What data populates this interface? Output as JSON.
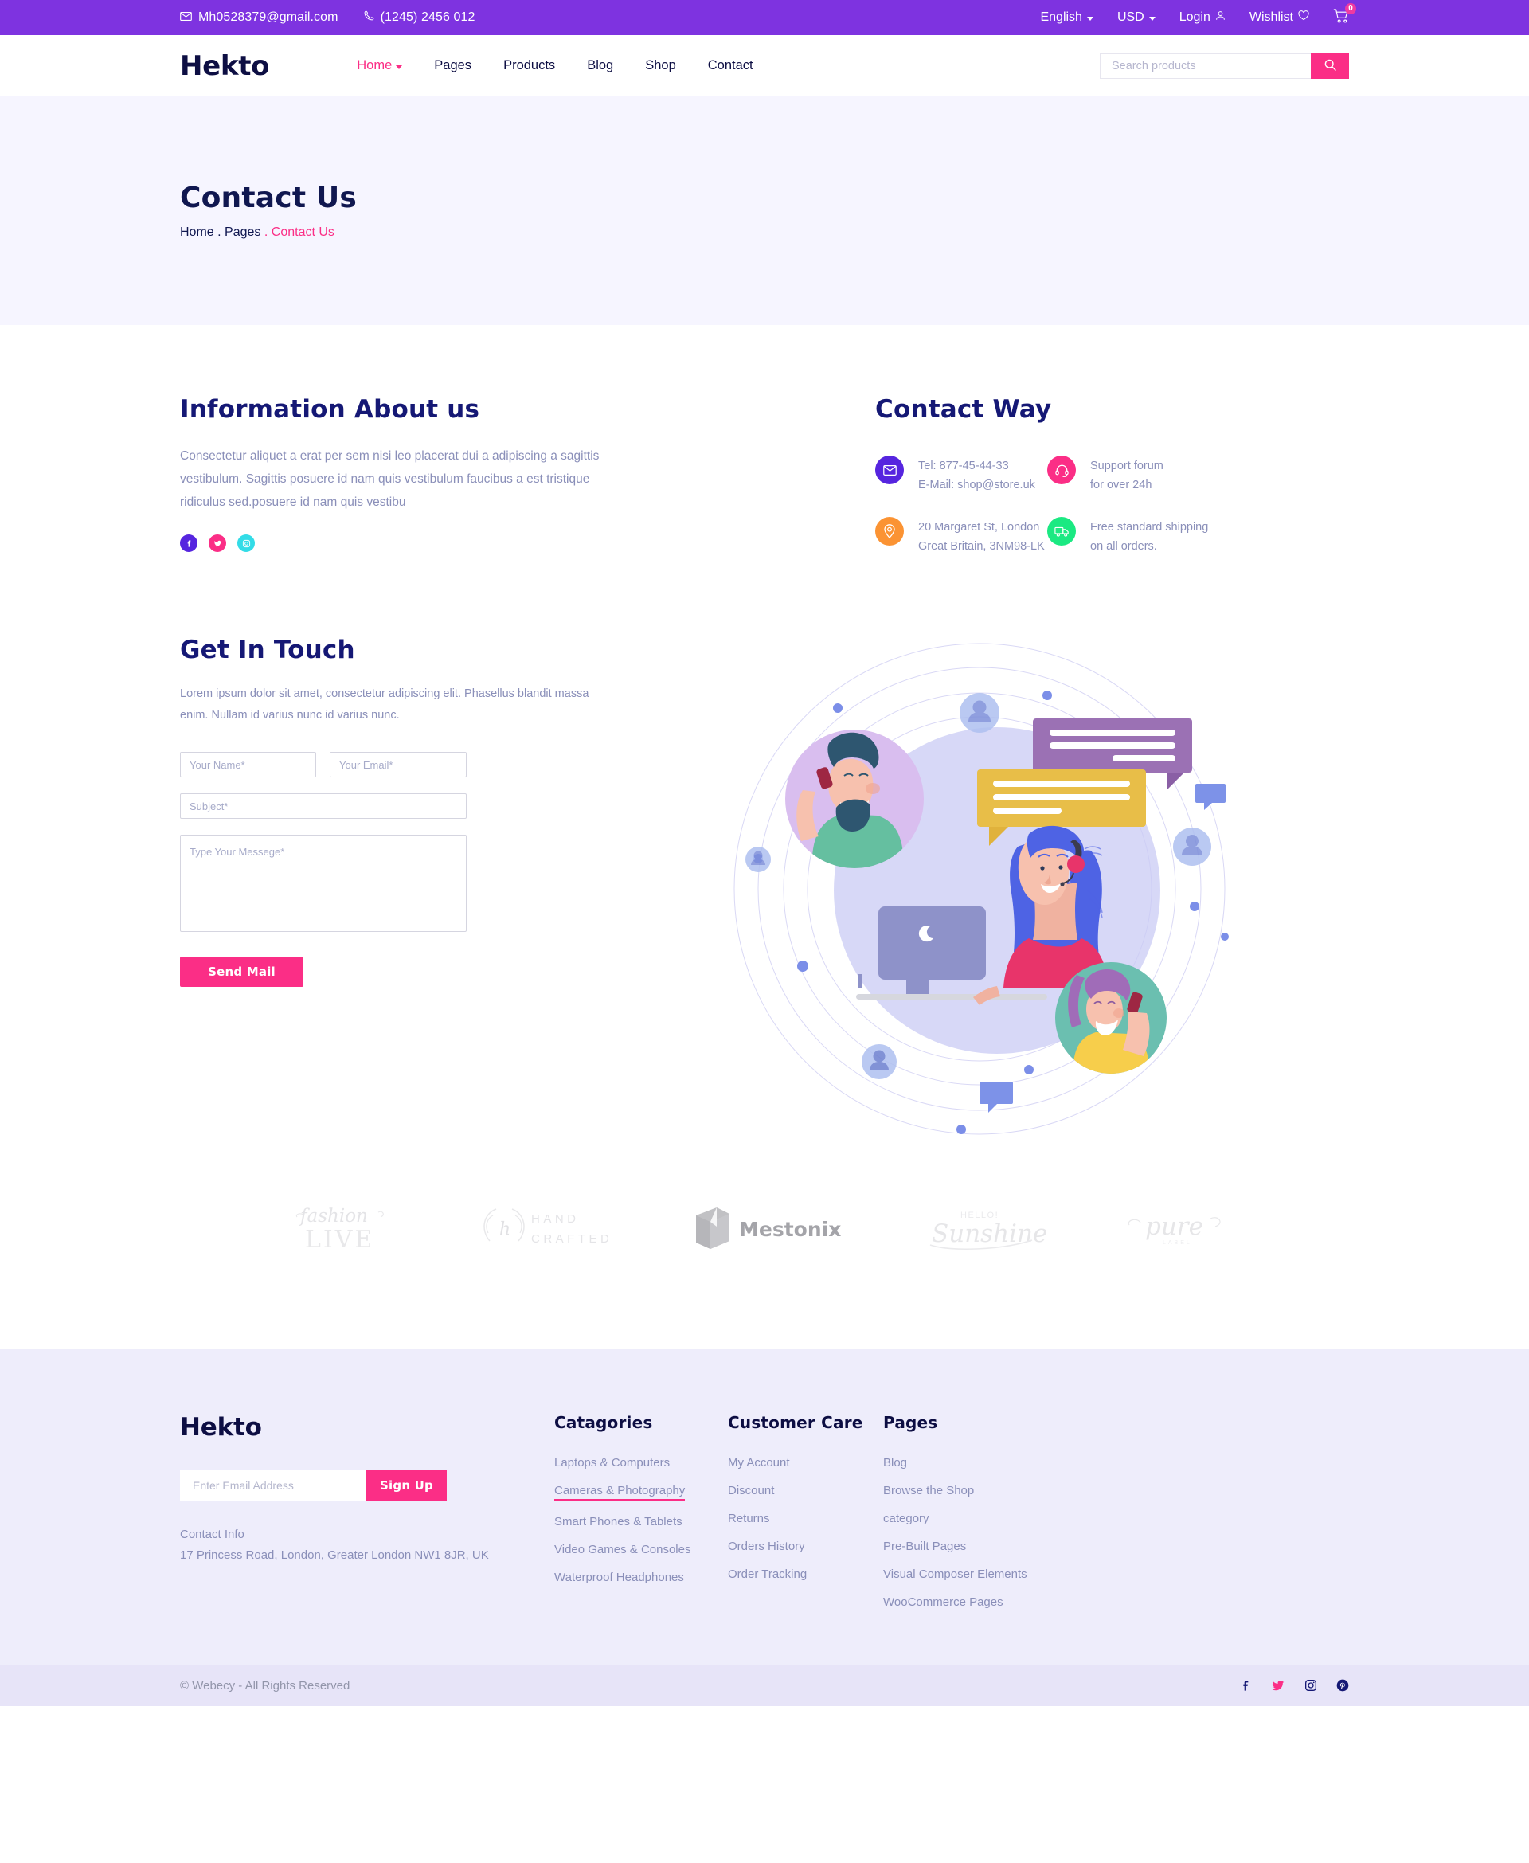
{
  "topbar": {
    "email": "Mh0528379@gmail.com",
    "phone": "(1245) 2456 012",
    "language": "English",
    "currency": "USD",
    "login": "Login",
    "wishlist": "Wishlist",
    "cart_count": "0"
  },
  "header": {
    "logo": "Hekto",
    "nav": [
      {
        "label": "Home",
        "active": true,
        "caret": true
      },
      {
        "label": "Pages",
        "active": false,
        "caret": false
      },
      {
        "label": "Products",
        "active": false,
        "caret": false
      },
      {
        "label": "Blog",
        "active": false,
        "caret": false
      },
      {
        "label": "Shop",
        "active": false,
        "caret": false
      },
      {
        "label": "Contact",
        "active": false,
        "caret": false
      }
    ],
    "search_placeholder": "Search products"
  },
  "hero": {
    "title": "Contact Us",
    "crumb_home": "Home",
    "crumb_sep1": ".",
    "crumb_pages": "Pages",
    "crumb_sep2": ".",
    "crumb_current": "Contact Us"
  },
  "info": {
    "title": "Information About us",
    "paragraph": "Consectetur aliquet a erat per sem nisi leo placerat dui a adipiscing a sagittis vestibulum. Sagittis posuere id nam quis vestibulum faucibus a est tristique ridiculus sed.posuere id nam quis vestibu",
    "socials": [
      {
        "name": "facebook-icon",
        "color": "#5625DF"
      },
      {
        "name": "twitter-icon",
        "color": "#FB2E86"
      },
      {
        "name": "instagram-icon",
        "color": "#33DCE7"
      }
    ]
  },
  "contact_way": {
    "title": "Contact Way",
    "items": [
      {
        "icon": "envelope-icon",
        "color": "#5625DF",
        "line1": "Tel: 877-45-44-33",
        "line2": "E-Mail: shop@store.uk"
      },
      {
        "icon": "headset-icon",
        "color": "#FB2E86",
        "line1": "Support forum",
        "line2": "for over 24h"
      },
      {
        "icon": "location-pin-icon",
        "color": "#FB9333",
        "line1": "20 Margaret St, London",
        "line2": "Great Britain, 3NM98-LK"
      },
      {
        "icon": "delivery-truck-icon",
        "color": "#1BE982",
        "line1": "Free standard shipping",
        "line2": "on all orders."
      }
    ]
  },
  "get_in_touch": {
    "title": "Get In Touch",
    "paragraph": "Lorem ipsum dolor sit amet, consectetur adipiscing elit. Phasellus blandit massa enim. Nullam id varius nunc id varius nunc.",
    "name_placeholder": "Your Name*",
    "email_placeholder": "Your Email*",
    "subject_placeholder": "Subject*",
    "message_placeholder": "Type Your Messege*",
    "send_label": "Send Mail"
  },
  "brands": [
    {
      "name": "fashion-live-logo",
      "line1": "fashion",
      "line2": "LIVE"
    },
    {
      "name": "hand-crafted-logo",
      "line1": "HAND",
      "line2": "CRAFTED"
    },
    {
      "name": "mestonix-logo",
      "line1": "Mestonix",
      "line2": ""
    },
    {
      "name": "hello-sunshine-logo",
      "line1": "HELLO!",
      "line2": "Sunshine"
    },
    {
      "name": "pure-logo",
      "line1": "pure",
      "line2": ""
    }
  ],
  "footer": {
    "logo": "Hekto",
    "email_placeholder": "Enter Email Address",
    "signup_label": "Sign Up",
    "contact_info_label": "Contact Info",
    "address": "17 Princess Road, London, Greater London NW1 8JR, UK",
    "columns": [
      {
        "title": "Catagories",
        "links": [
          {
            "label": "Laptops & Computers",
            "highlight": false
          },
          {
            "label": "Cameras & Photography",
            "highlight": true
          },
          {
            "label": "Smart Phones & Tablets",
            "highlight": false
          },
          {
            "label": "Video Games & Consoles",
            "highlight": false
          },
          {
            "label": "Waterproof Headphones",
            "highlight": false
          }
        ]
      },
      {
        "title": "Customer Care",
        "links": [
          {
            "label": "My Account",
            "highlight": false
          },
          {
            "label": "Discount",
            "highlight": false
          },
          {
            "label": "Returns",
            "highlight": false
          },
          {
            "label": "Orders History",
            "highlight": false
          },
          {
            "label": "Order Tracking",
            "highlight": false
          }
        ]
      },
      {
        "title": "Pages",
        "links": [
          {
            "label": "Blog",
            "highlight": false
          },
          {
            "label": "Browse the Shop",
            "highlight": false
          },
          {
            "label": "category",
            "highlight": false
          },
          {
            "label": "Pre-Built Pages",
            "highlight": false
          },
          {
            "label": "Visual Composer Elements",
            "highlight": false
          },
          {
            "label": "WooCommerce Pages",
            "highlight": false
          }
        ]
      }
    ],
    "copyright": "© Webecy - All Rights Reserved",
    "socials": [
      {
        "name": "facebook-icon",
        "color": "#151875"
      },
      {
        "name": "twitter-icon",
        "color": "#FB2E86"
      },
      {
        "name": "instagram-icon",
        "color": "#151875"
      },
      {
        "name": "pinterest-icon",
        "color": "#151875"
      }
    ]
  },
  "colors": {
    "purple": "#7E33E0",
    "pink": "#FB2E86",
    "navy": "#0D0E43",
    "muted": "#8A8FB9",
    "hero_bg": "#F6F5FF",
    "footer_bg": "#EEEDFB",
    "copybar_bg": "#E7E4F8"
  }
}
